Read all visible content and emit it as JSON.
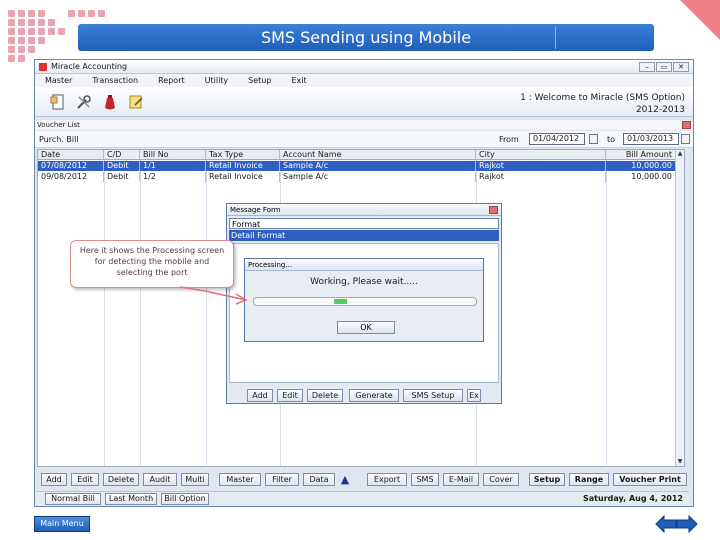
{
  "slide": {
    "title": "SMS Sending using Mobile",
    "main_menu_label": "Main Menu",
    "prev_icon": "left-arrow-icon",
    "next_icon": "right-arrow-icon"
  },
  "app": {
    "window_title": "Miracle Accounting",
    "menu": [
      "Master",
      "Transaction",
      "Report",
      "Utility",
      "Setup",
      "Exit"
    ],
    "toolbar_icons": [
      "new-document-icon",
      "tools-icon",
      "money-bag-icon",
      "edit-note-icon"
    ],
    "welcome_line1": "1 : Welcome to Miracle (SMS Option)",
    "welcome_line2": "2012-2013",
    "voucher_list_label": "Voucher List",
    "filter_label": "Purch. Bill",
    "from_label": "From",
    "from_date": "01/04/2012",
    "to_label": "to",
    "to_date": "01/03/2013"
  },
  "grid": {
    "columns": [
      "Date",
      "C/D",
      "Bill No",
      "Tax Type",
      "Account Name",
      "City",
      "Bill Amount"
    ],
    "rows": [
      [
        "07/08/2012",
        "Debit",
        "1/1",
        "Retail Invoice",
        "Sample A/c",
        "Rajkot",
        "10,000.00"
      ],
      [
        "09/08/2012",
        "Debit",
        "1/2",
        "Retail Invoice",
        "Sample A/c",
        "Rajkot",
        "10,000.00"
      ]
    ]
  },
  "bottom_buttons": [
    "Add",
    "Edit",
    "Delete",
    "Audit",
    "Multi",
    "Master",
    "Filter",
    "Data",
    "Export",
    "SMS",
    "E-Mail",
    "Cover",
    "Setup",
    "Range",
    "Voucher Print"
  ],
  "status_buttons": [
    "Normal Bill",
    "Last Month",
    "Bill Option"
  ],
  "status_date": "Saturday, Aug 4, 2012",
  "message_form": {
    "title": "Message Form",
    "items": [
      "Format",
      "Detail Format"
    ],
    "buttons": [
      "Add",
      "Edit",
      "Delete",
      "Generate",
      "SMS Setup",
      "Ex"
    ]
  },
  "processing": {
    "title": "Processing...",
    "message": "Working, Please wait.....",
    "ok_label": "OK",
    "progress": 0.06
  },
  "callout": {
    "text": "Here it shows the Processing screen for detecting the mobile and selecting the port"
  },
  "colors": {
    "title_bar": "#2a6fd0",
    "selection": "#2f5fc0",
    "progress": "#55cc66",
    "accent_corner": "#f07e84"
  }
}
